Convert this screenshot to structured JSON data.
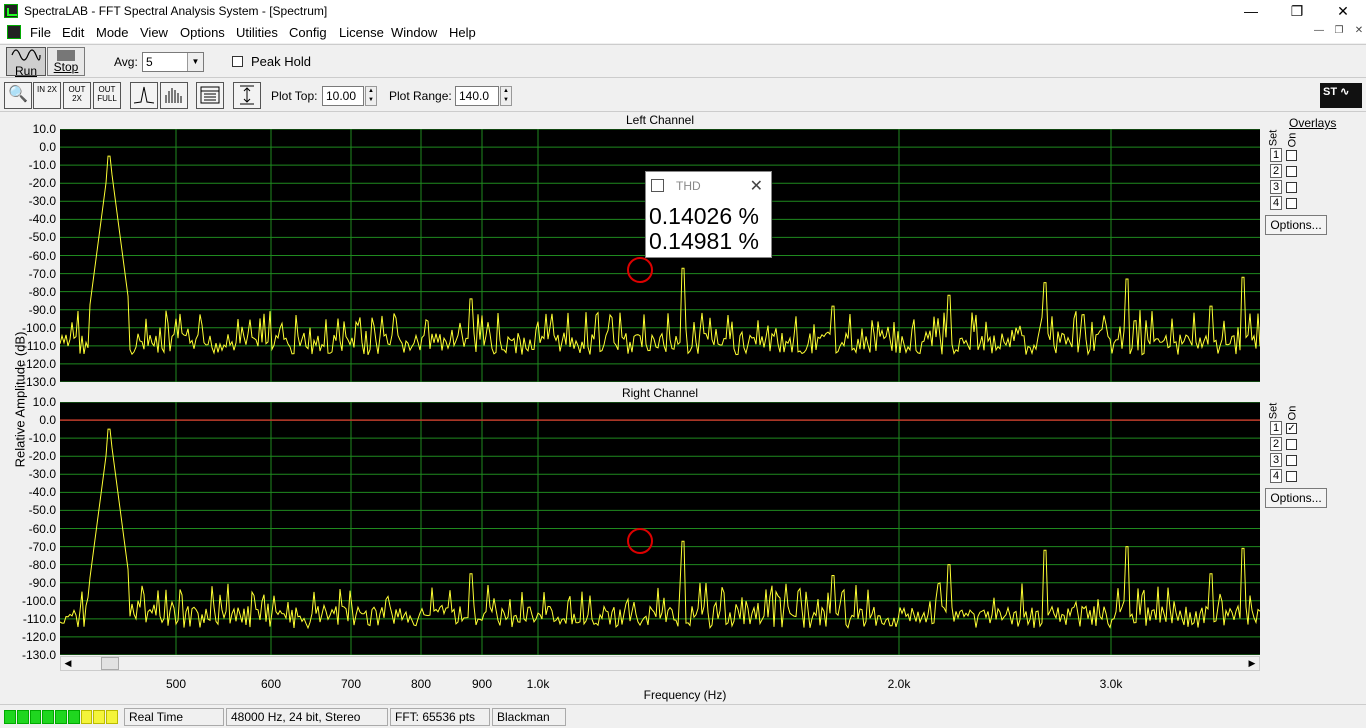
{
  "window": {
    "title": "SpectraLAB - FFT Spectral Analysis System - [Spectrum]"
  },
  "menu": [
    "File",
    "Edit",
    "Mode",
    "View",
    "Options",
    "Utilities",
    "Config",
    "License",
    "Window",
    "Help"
  ],
  "toolbar1": {
    "run_label": "Run",
    "stop_label": "Stop",
    "avg_label": "Avg:",
    "avg_value": "5",
    "peak_hold_label": "Peak Hold"
  },
  "toolbar2": {
    "zoom_in_2x": "IN 2X",
    "zoom_out_2x": "OUT 2X",
    "zoom_out_full": "OUT FULL",
    "plot_top_label": "Plot Top:",
    "plot_top_value": "10.00",
    "plot_range_label": "Plot Range:",
    "plot_range_value": "140.0",
    "logo_text": "ST"
  },
  "overlays": {
    "title": "Overlays",
    "set_label": "Set",
    "on_label": "On",
    "numbers": [
      "1",
      "2",
      "3",
      "4"
    ],
    "options_label": "Options...",
    "left_checked": [
      false,
      false,
      false,
      false
    ],
    "right_checked": [
      true,
      false,
      false,
      false
    ]
  },
  "thd_popup": {
    "title": "THD",
    "left_value": "0.14026 %",
    "right_value": "0.14981 %"
  },
  "chart_data": [
    {
      "type": "line",
      "title": "Left Channel",
      "ylabel": "Relative Amplitude (dB)",
      "xlabel": "Frequency (Hz)",
      "ylim": [
        -130,
        10
      ],
      "yticks": [
        "10.0",
        "0.0",
        "-10.0",
        "-20.0",
        "-30.0",
        "-40.0",
        "-50.0",
        "-60.0",
        "-70.0",
        "-80.0",
        "-90.0",
        "-100.0",
        "-110.0",
        "-120.0",
        "-130.0"
      ],
      "xscale": "log",
      "xticks": [
        "500",
        "600",
        "700",
        "800",
        "900",
        "1.0k",
        "2.0k",
        "3.0k"
      ],
      "grid": true,
      "series": [
        {
          "color": "#ffff33",
          "x": [
            440,
            880,
            1320,
            1760,
            2200,
            2640,
            3080,
            3520,
            3700
          ],
          "values": [
            -5,
            -84,
            -67,
            -88,
            -82,
            -75,
            -73,
            -88,
            -72
          ]
        }
      ]
    },
    {
      "type": "line",
      "title": "Right Channel",
      "ylabel": "Relative Amplitude (dB)",
      "xlabel": "Frequency (Hz)",
      "ylim": [
        -130,
        10
      ],
      "yticks": [
        "10.0",
        "0.0",
        "-10.0",
        "-20.0",
        "-30.0",
        "-40.0",
        "-50.0",
        "-60.0",
        "-70.0",
        "-80.0",
        "-90.0",
        "-100.0",
        "-110.0",
        "-120.0",
        "-130.0"
      ],
      "xscale": "log",
      "xticks": [
        "500",
        "600",
        "700",
        "800",
        "900",
        "1.0k",
        "2.0k",
        "3.0k"
      ],
      "grid": true,
      "series": [
        {
          "color": "#ffff33",
          "x": [
            440,
            880,
            1320,
            1760,
            2200,
            2640,
            3080,
            3520,
            3700
          ],
          "values": [
            -5,
            -85,
            -67,
            -86,
            -80,
            -72,
            -70,
            -85,
            -71
          ]
        }
      ],
      "overlay_line": {
        "color": "#c0392b",
        "value": 0
      }
    }
  ],
  "statusbar": {
    "mode": "Real Time",
    "format": "48000 Hz, 24 bit, Stereo",
    "fft": "FFT: 65536 pts",
    "window": "Blackman"
  },
  "colors": {
    "plot_bg": "#000000",
    "grid": "#1f8a1f",
    "trace": "#ffff33",
    "marker": "#dd0000"
  }
}
